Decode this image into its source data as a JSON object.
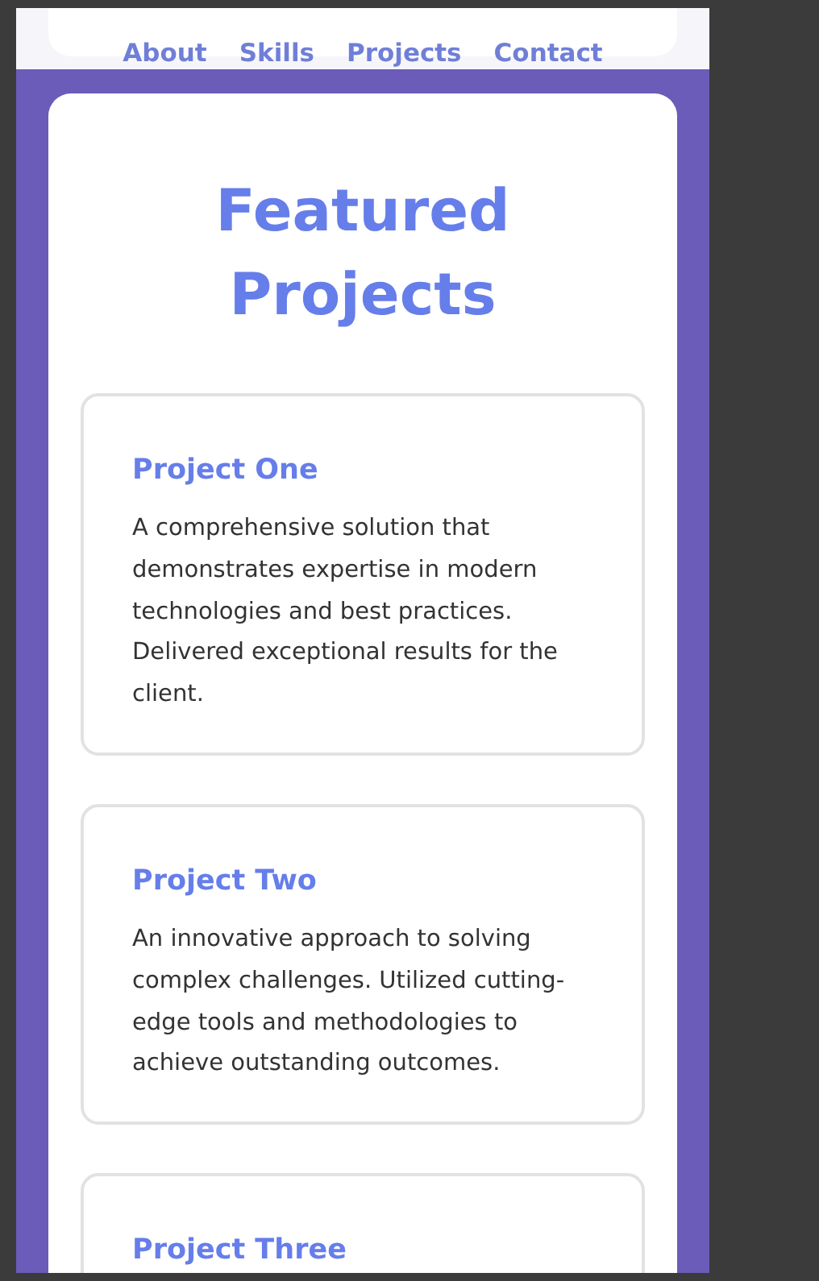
{
  "nav": {
    "links": [
      "About",
      "Skills",
      "Projects",
      "Contact"
    ]
  },
  "section": {
    "title": "Featured Projects",
    "projects": [
      {
        "title": "Project One",
        "description": "A comprehensive solution that demonstrates expertise in modern technologies and best practices. Delivered exceptional results for the client."
      },
      {
        "title": "Project Two",
        "description": "An innovative approach to solving complex challenges. Utilized cutting-edge tools and methodologies to achieve outstanding outcomes."
      },
      {
        "title": "Project Three"
      }
    ]
  }
}
